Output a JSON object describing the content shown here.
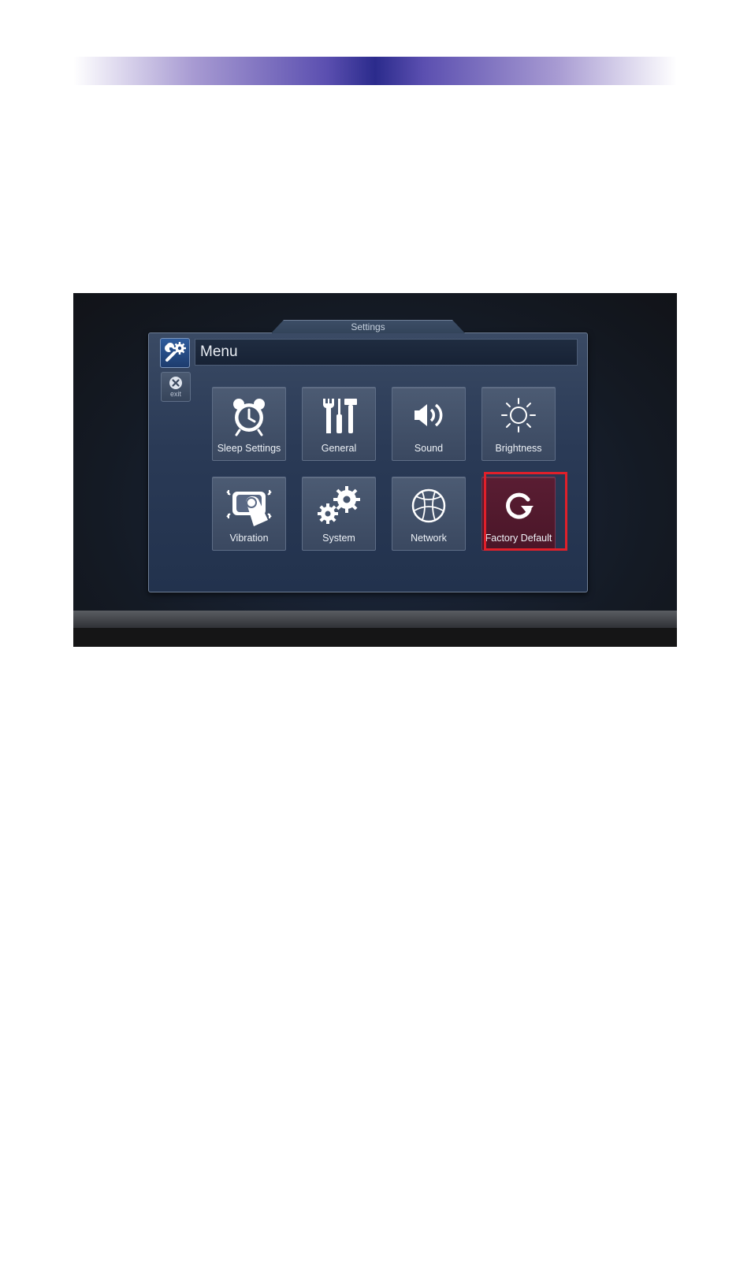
{
  "header": {
    "accent_color": "#2b2b8c"
  },
  "window": {
    "tab_label": "Settings",
    "title": "Menu",
    "title_icon": "wrench-gear-icon",
    "exit_label": "exit",
    "exit_icon": "close-circle-icon"
  },
  "tiles": [
    {
      "label": "Sleep Settings",
      "icon": "alarm-clock-icon",
      "selected": false
    },
    {
      "label": "General",
      "icon": "tools-icon",
      "selected": false
    },
    {
      "label": "Sound",
      "icon": "speaker-icon",
      "selected": false
    },
    {
      "label": "Brightness",
      "icon": "sun-icon",
      "selected": false
    },
    {
      "label": "Vibration",
      "icon": "vibration-icon",
      "selected": false
    },
    {
      "label": "System",
      "icon": "gears-icon",
      "selected": false
    },
    {
      "label": "Network",
      "icon": "globe-icon",
      "selected": false
    },
    {
      "label": "Factory Default",
      "icon": "reset-arrow-icon",
      "selected": true
    }
  ],
  "highlight_color": "#e0202a"
}
